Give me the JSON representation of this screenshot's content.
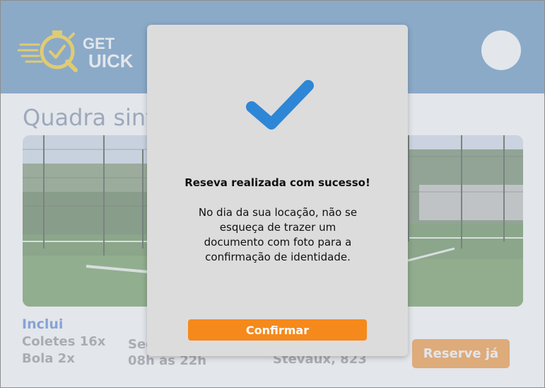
{
  "header": {
    "logo_text": "GET QUICK",
    "logo_line1": "GET",
    "logo_line2": "UICK"
  },
  "page": {
    "title": "Quadra sintética",
    "inclui": {
      "title": "Inclui",
      "items": [
        "Coletes 16x",
        "Bola 2x"
      ]
    },
    "schedule": {
      "days": "Seg a Sex",
      "hours": "08h às 22h"
    },
    "address": "Stevaux, 823",
    "reserve_button": "Reserve já"
  },
  "modal": {
    "title": "Reseva realizada com sucesso!",
    "body_lines": [
      "No dia da sua locação, não se",
      "esqueça de trazer um",
      "documento com foto para a",
      "confirmação de identidade."
    ],
    "confirm_button": "Confirmar",
    "icon": "check-icon"
  },
  "colors": {
    "header": "#4f87b8",
    "accent": "#f5891c",
    "logo_yellow": "#f6c90e",
    "check_blue": "#2e86d6",
    "inclui_blue": "#4779d4"
  }
}
